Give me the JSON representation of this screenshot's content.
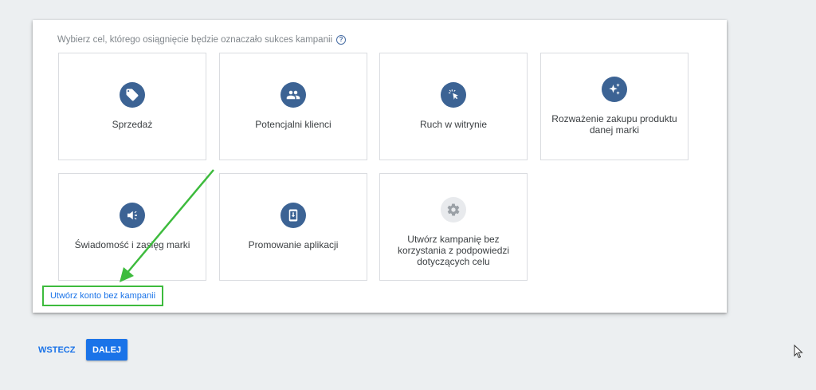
{
  "goal_prompt": "Wybierz cel, którego osiągnięcie będzie oznaczało sukces kampanii",
  "help_icon_glyph": "?",
  "tiles": [
    {
      "label": "Sprzedaż",
      "icon": "tag-icon"
    },
    {
      "label": "Potencjalni klienci",
      "icon": "people-icon"
    },
    {
      "label": "Ruch w witrynie",
      "icon": "cursor-click-icon"
    },
    {
      "label": "Rozważenie zakupu produktu danej marki",
      "icon": "sparkle-icon"
    },
    {
      "label": "Świadomość i zasięg marki",
      "icon": "megaphone-icon"
    },
    {
      "label": "Promowanie aplikacji",
      "icon": "phone-download-icon"
    },
    {
      "label": "Utwórz kampanię bez korzystania z podpowiedzi dotyczących celu",
      "icon": "gear-icon"
    }
  ],
  "create_account_link": "Utwórz konto bez kampanii",
  "back_button": "WSTECZ",
  "next_button": "DALEJ",
  "colors": {
    "icon_bg": "#3c6394",
    "accent": "#1a73e8",
    "highlight_green": "#3dbb3d"
  }
}
